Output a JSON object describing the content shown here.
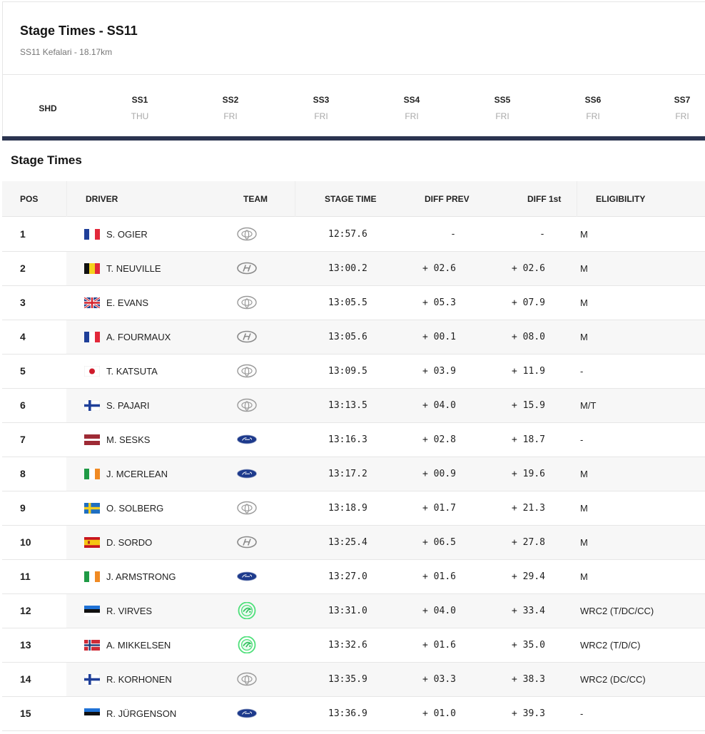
{
  "header": {
    "title": "Stage Times - SS11",
    "subtitle": "SS11 Kefalari - 18.17km"
  },
  "stages": [
    {
      "code": "SHD",
      "day": ""
    },
    {
      "code": "SS1",
      "day": "THU"
    },
    {
      "code": "SS2",
      "day": "FRI"
    },
    {
      "code": "SS3",
      "day": "FRI"
    },
    {
      "code": "SS4",
      "day": "FRI"
    },
    {
      "code": "SS5",
      "day": "FRI"
    },
    {
      "code": "SS6",
      "day": "FRI"
    },
    {
      "code": "SS7",
      "day": "FRI"
    }
  ],
  "section_title": "Stage Times",
  "columns": {
    "pos": "POS",
    "driver": "DRIVER",
    "team": "TEAM",
    "stage_time": "STAGE TIME",
    "diff_prev": "DIFF PREV",
    "diff_first": "DIFF 1st",
    "eligibility": "ELIGIBILITY"
  },
  "rows": [
    {
      "pos": "1",
      "country": "france",
      "driver": "S. OGIER",
      "team": "toyota-logo-icon",
      "stage_time": "12:57.6",
      "diff_prev": "-",
      "diff_first": "-",
      "eligibility": "M"
    },
    {
      "pos": "2",
      "country": "belgium",
      "driver": "T. NEUVILLE",
      "team": "hyundai-logo-icon",
      "stage_time": "13:00.2",
      "diff_prev": "+ 02.6",
      "diff_first": "+ 02.6",
      "eligibility": "M"
    },
    {
      "pos": "3",
      "country": "uk",
      "driver": "E. EVANS",
      "team": "toyota-logo-icon",
      "stage_time": "13:05.5",
      "diff_prev": "+ 05.3",
      "diff_first": "+ 07.9",
      "eligibility": "M"
    },
    {
      "pos": "4",
      "country": "france",
      "driver": "A. FOURMAUX",
      "team": "hyundai-logo-icon",
      "stage_time": "13:05.6",
      "diff_prev": "+ 00.1",
      "diff_first": "+ 08.0",
      "eligibility": "M"
    },
    {
      "pos": "5",
      "country": "japan",
      "driver": "T. KATSUTA",
      "team": "toyota-logo-icon",
      "stage_time": "13:09.5",
      "diff_prev": "+ 03.9",
      "diff_first": "+ 11.9",
      "eligibility": "-"
    },
    {
      "pos": "6",
      "country": "finland",
      "driver": "S. PAJARI",
      "team": "toyota-logo-icon",
      "stage_time": "13:13.5",
      "diff_prev": "+ 04.0",
      "diff_first": "+ 15.9",
      "eligibility": "M/T"
    },
    {
      "pos": "7",
      "country": "latvia",
      "driver": "M. SESKS",
      "team": "ford-logo-icon",
      "stage_time": "13:16.3",
      "diff_prev": "+ 02.8",
      "diff_first": "+ 18.7",
      "eligibility": "-"
    },
    {
      "pos": "8",
      "country": "ireland",
      "driver": "J. MCERLEAN",
      "team": "ford-logo-icon",
      "stage_time": "13:17.2",
      "diff_prev": "+ 00.9",
      "diff_first": "+ 19.6",
      "eligibility": "M"
    },
    {
      "pos": "9",
      "country": "sweden",
      "driver": "O. SOLBERG",
      "team": "toyota-logo-icon",
      "stage_time": "13:18.9",
      "diff_prev": "+ 01.7",
      "diff_first": "+ 21.3",
      "eligibility": "M"
    },
    {
      "pos": "10",
      "country": "spain",
      "driver": "D. SORDO",
      "team": "hyundai-logo-icon",
      "stage_time": "13:25.4",
      "diff_prev": "+ 06.5",
      "diff_first": "+ 27.8",
      "eligibility": "M"
    },
    {
      "pos": "11",
      "country": "ireland",
      "driver": "J. ARMSTRONG",
      "team": "ford-logo-icon",
      "stage_time": "13:27.0",
      "diff_prev": "+ 01.6",
      "diff_first": "+ 29.4",
      "eligibility": "M"
    },
    {
      "pos": "12",
      "country": "estonia",
      "driver": "R. VIRVES",
      "team": "skoda-logo-icon",
      "stage_time": "13:31.0",
      "diff_prev": "+ 04.0",
      "diff_first": "+ 33.4",
      "eligibility": "WRC2 (T/DC/CC)"
    },
    {
      "pos": "13",
      "country": "norway",
      "driver": "A. MIKKELSEN",
      "team": "skoda-logo-icon",
      "stage_time": "13:32.6",
      "diff_prev": "+ 01.6",
      "diff_first": "+ 35.0",
      "eligibility": "WRC2 (T/D/C)"
    },
    {
      "pos": "14",
      "country": "finland",
      "driver": "R. KORHONEN",
      "team": "toyota-logo-icon",
      "stage_time": "13:35.9",
      "diff_prev": "+ 03.3",
      "diff_first": "+ 38.3",
      "eligibility": "WRC2 (DC/CC)"
    },
    {
      "pos": "15",
      "country": "estonia",
      "driver": "R. JÜRGENSON",
      "team": "ford-logo-icon",
      "stage_time": "13:36.9",
      "diff_prev": "+ 01.0",
      "diff_first": "+ 39.3",
      "eligibility": "-"
    }
  ],
  "colors": {
    "accent_bar": "#2b3450",
    "skoda_green": "#4ee07a",
    "ford_blue": "#1d3a8c"
  }
}
